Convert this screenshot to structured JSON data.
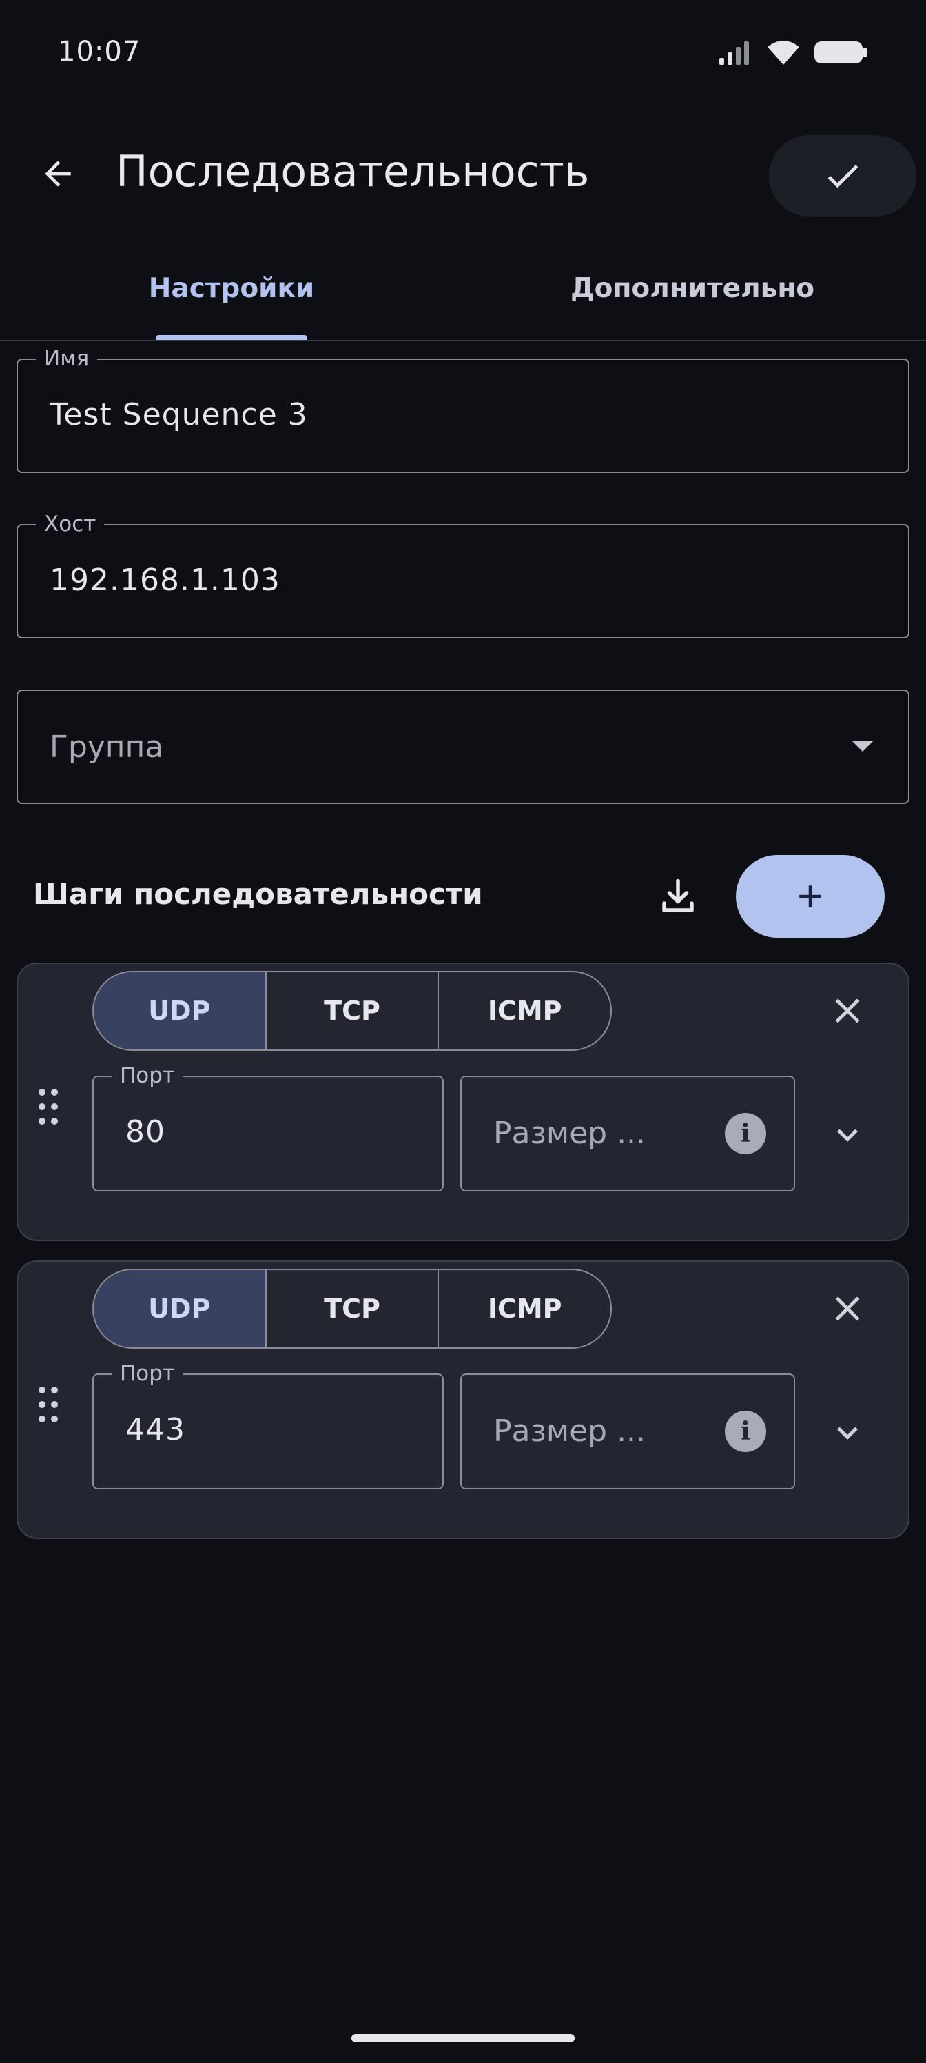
{
  "status_bar": {
    "time": "10:07"
  },
  "app_bar": {
    "title": "Последовательность"
  },
  "tabs": [
    {
      "label": "Настройки",
      "selected": true
    },
    {
      "label": "Дополнительно",
      "selected": false
    }
  ],
  "form": {
    "name": {
      "label": "Имя",
      "value": "Test Sequence 3"
    },
    "host": {
      "label": "Хост",
      "value": "192.168.1.103"
    },
    "group": {
      "placeholder": "Группа"
    }
  },
  "steps": {
    "title": "Шаги последовательности",
    "items": [
      {
        "protocols": [
          "UDP",
          "TCP",
          "ICMP"
        ],
        "selected_protocol": "UDP",
        "port_label": "Порт",
        "port_value": "80",
        "size_placeholder": "Размер ..."
      },
      {
        "protocols": [
          "UDP",
          "TCP",
          "ICMP"
        ],
        "selected_protocol": "UDP",
        "port_label": "Порт",
        "port_value": "443",
        "size_placeholder": "Размер ..."
      }
    ]
  },
  "icons": {
    "back": "arrow-back-icon",
    "save": "check-icon",
    "import": "download-icon",
    "add": "plus-icon",
    "remove_step": "close-icon",
    "expand_step": "chevron-down-icon",
    "drag": "drag-handle-icon",
    "info": "info-icon"
  },
  "colors": {
    "background": "#0e0f14",
    "card": "#232630",
    "accent": "#b3c3f0",
    "selected_segment": "#394160"
  }
}
